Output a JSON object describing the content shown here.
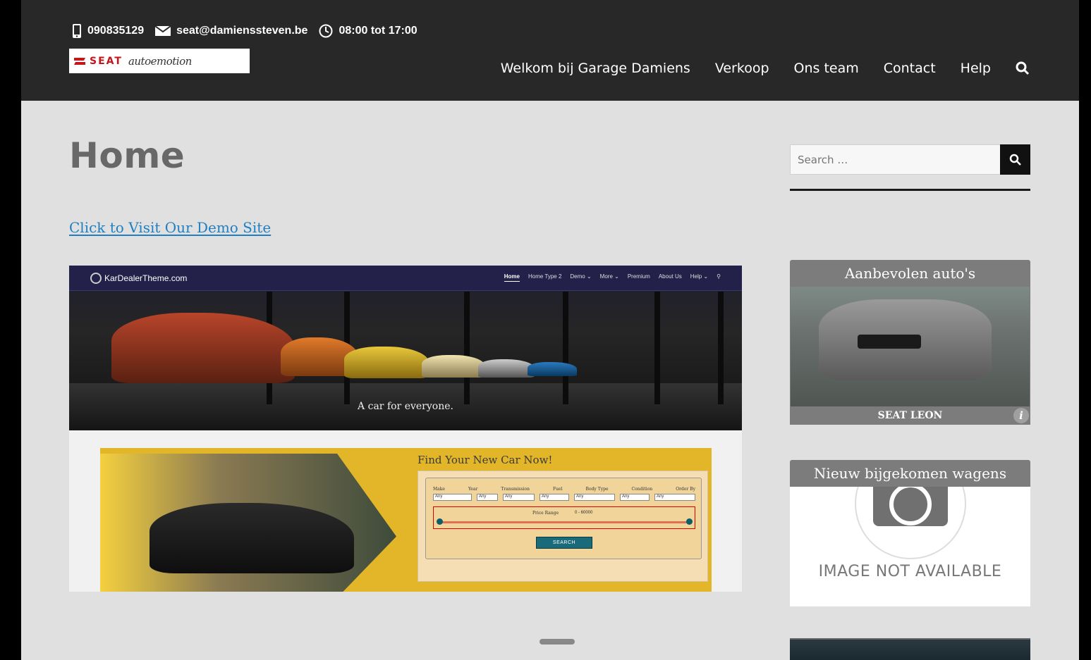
{
  "header": {
    "phone": "090835129",
    "email": "seat@damienssteven.be",
    "hours": "08:00 tot 17:00",
    "logo_brand": "SEAT",
    "logo_script": "autoemotion"
  },
  "nav": {
    "items": [
      "Welkom bij Garage Damiens",
      "Verkoop",
      "Ons team",
      "Contact",
      "Help"
    ]
  },
  "main": {
    "title": "Home",
    "demo_link": "Click to Visit Our Demo Site",
    "preview": {
      "brand": "KarDealerTheme.com",
      "nav": [
        "Home",
        "Home Type 2",
        "Demo ⌄",
        "More ⌄",
        "Premium",
        "About Us",
        "Help ⌄",
        "⚲"
      ],
      "tagline": "A car for everyone.",
      "finder_title": "Find Your New Car Now!",
      "labels": [
        "Make",
        "Year",
        "Transmission",
        "Fuel",
        "Body Type",
        "Condition",
        "Order By"
      ],
      "select_value": "Any",
      "price_label": "Price Range",
      "price_range": "0 - 60000",
      "search_label": "SEARCH"
    }
  },
  "sidebar": {
    "search_placeholder": "Search …",
    "widget1_title": "Aanbevolen auto's",
    "widget1_caption": "SEAT LEON",
    "widget2_title": "Nieuw bijgekomen wagens",
    "widget2_image_text": "IMAGE NOT AVAILABLE"
  },
  "colors": {
    "header_bg": "#282828",
    "page_bg": "#e0e0e0",
    "link": "#1f7fc0",
    "widget_header": "#7c7c7c",
    "accent_red": "#c4161c"
  }
}
